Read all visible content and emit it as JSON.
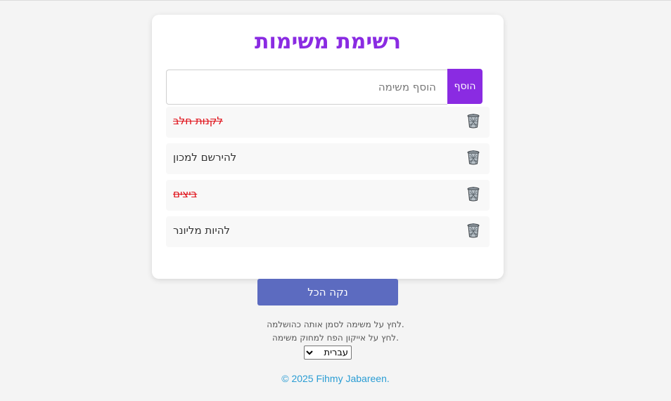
{
  "title": "רשימת משימות",
  "add_form": {
    "placeholder": "הוסף משימה",
    "value": "",
    "add_label": "הוסף"
  },
  "tasks": [
    {
      "text": "לקנות חלב",
      "completed": true
    },
    {
      "text": "להירשם למכון",
      "completed": false
    },
    {
      "text": "ביצים",
      "completed": true
    },
    {
      "text": "להיות מליונר",
      "completed": false
    }
  ],
  "clear_all_label": "נקה הכל",
  "hints": [
    "לחץ על משימה לסמן אותה כהושלמה.",
    "לחץ על אייקון הפח למחוק משימה."
  ],
  "language": {
    "selected": "עברית"
  },
  "footer": "© 2025 Fihmy Jabareen.",
  "colors": {
    "accent": "#8a2be2",
    "done_text": "#e0121a",
    "clear_button": "#5c6bc0",
    "footer_link": "#2a9dd4"
  },
  "icons": {
    "delete": "trash-can-icon"
  }
}
